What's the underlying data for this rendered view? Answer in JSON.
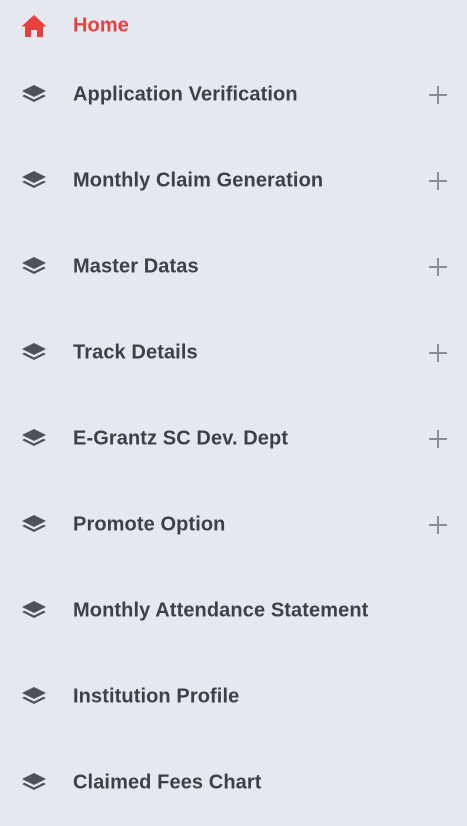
{
  "colors": {
    "background": "#e6e8ef",
    "accent": "#e8403f",
    "text": "#3d4046",
    "icon": "#4d5158",
    "expand": "#8a8d93"
  },
  "sidebar": {
    "home": {
      "label": "Home",
      "icon": "home-icon"
    },
    "items": [
      {
        "label": "Application Verification",
        "icon": "layers-icon",
        "expandable": true
      },
      {
        "label": "Monthly Claim Generation",
        "icon": "layers-icon",
        "expandable": true
      },
      {
        "label": "Master Datas",
        "icon": "layers-icon",
        "expandable": true
      },
      {
        "label": "Track Details",
        "icon": "layers-icon",
        "expandable": true
      },
      {
        "label": "E-Grantz SC Dev. Dept",
        "icon": "layers-icon",
        "expandable": true
      },
      {
        "label": "Promote Option",
        "icon": "layers-icon",
        "expandable": true
      },
      {
        "label": "Monthly Attendance Statement",
        "icon": "layers-icon",
        "expandable": false
      },
      {
        "label": "Institution Profile",
        "icon": "layers-icon",
        "expandable": false
      },
      {
        "label": "Claimed Fees Chart",
        "icon": "layers-icon",
        "expandable": false
      }
    ]
  }
}
